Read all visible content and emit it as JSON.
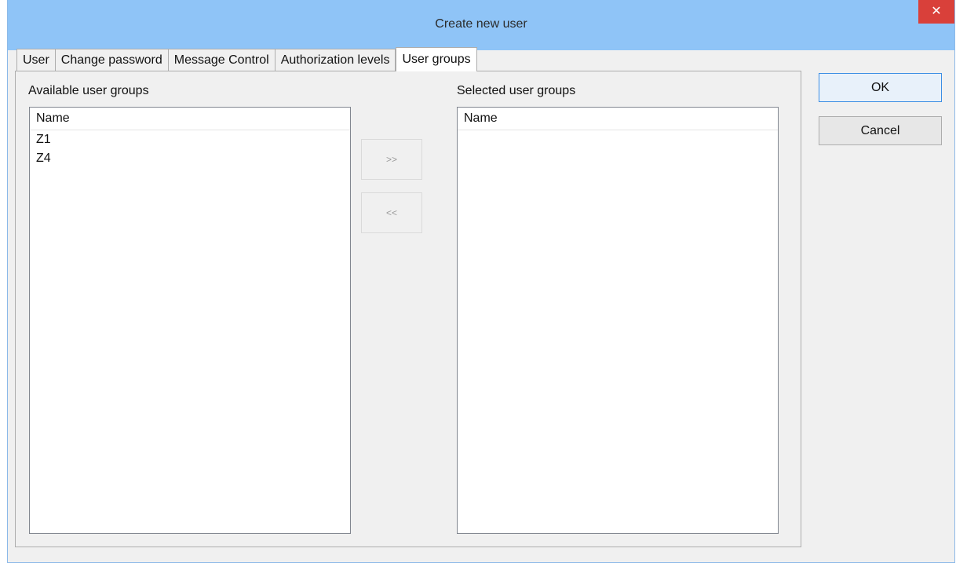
{
  "window": {
    "title": "Create new user",
    "close_glyph": "✕"
  },
  "tabs": [
    {
      "label": "User",
      "active": false
    },
    {
      "label": "Change password",
      "active": false
    },
    {
      "label": "Message Control",
      "active": false
    },
    {
      "label": "Authorization levels",
      "active": false
    },
    {
      "label": "User groups",
      "active": true
    }
  ],
  "available": {
    "label": "Available user groups",
    "column_header": "Name",
    "items": [
      "Z1",
      "Z4"
    ]
  },
  "selected": {
    "label": "Selected user groups",
    "column_header": "Name",
    "items": []
  },
  "move": {
    "add_label": ">>",
    "remove_label": "<<"
  },
  "buttons": {
    "ok_label": "OK",
    "cancel_label": "Cancel"
  },
  "colors": {
    "titlebar": "#8fc4f7",
    "close": "#d9403a",
    "default_button_border": "#3c8ee4"
  }
}
